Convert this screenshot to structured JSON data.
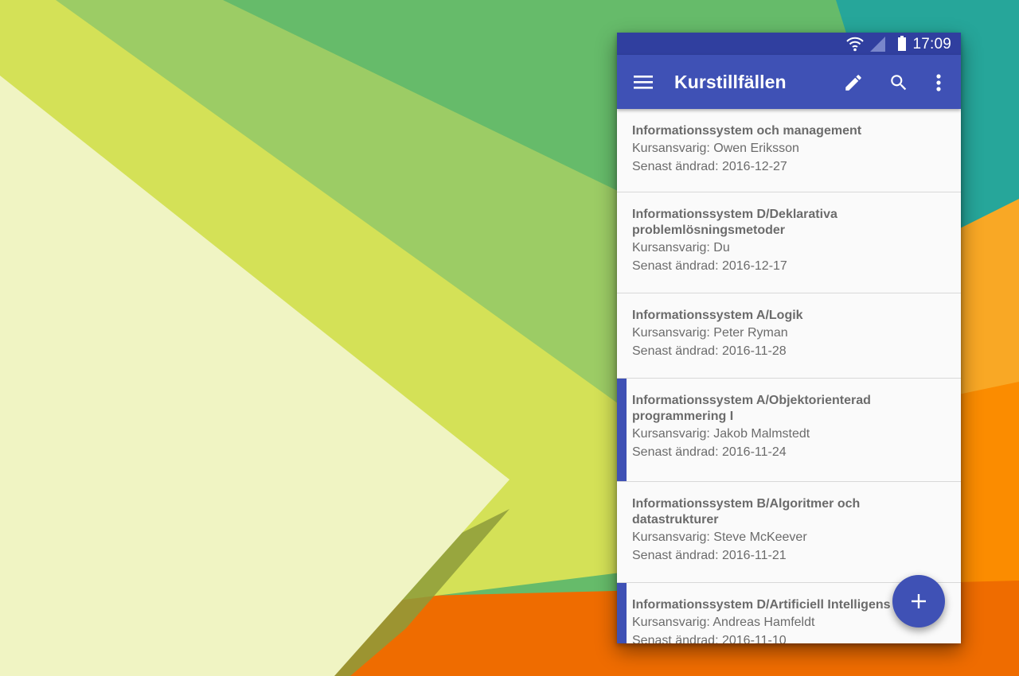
{
  "status_bar": {
    "time": "17:09",
    "icons": [
      "wifi-icon",
      "cell-signal-icon",
      "battery-icon"
    ]
  },
  "app_bar": {
    "title": "Kurstillfällen",
    "actions": [
      "menu-icon",
      "edit-icon",
      "search-icon",
      "more-vert-icon"
    ]
  },
  "courses": [
    {
      "title": "Informationssystem och management",
      "responsible": "Kursansvarig: Owen Eriksson",
      "modified": "Senast ändrad: 2016-12-27",
      "selected": false
    },
    {
      "title": "Informationssystem D/Deklarativa problemlösningsmetoder",
      "responsible": "Kursansvarig: Du",
      "modified": "Senast ändrad: 2016-12-17",
      "selected": false
    },
    {
      "title": "Informationssystem A/Logik",
      "responsible": "Kursansvarig: Peter Ryman",
      "modified": "Senast ändrad: 2016-11-28",
      "selected": false
    },
    {
      "title": "Informationssystem A/Objektorienterad programmering I",
      "responsible": "Kursansvarig: Jakob Malmstedt",
      "modified": "Senast ändrad: 2016-11-24",
      "selected": true
    },
    {
      "title": "Informationssystem B/Algoritmer och datastrukturer",
      "responsible": "Kursansvarig: Steve McKeever",
      "modified": "Senast ändrad: 2016-11-21",
      "selected": false
    },
    {
      "title": "Informationssystem D/Artificiell Intelligens",
      "responsible": "Kursansvarig: Andreas Hamfeldt",
      "modified": "Senast ändrad: 2016-11-10",
      "selected": true
    }
  ],
  "fab": {
    "icon": "add-icon",
    "label": "+"
  },
  "colors": {
    "primary": "#3f51b5",
    "primary_dark": "#303f9f",
    "list_background": "#fafafa",
    "text": "#6b6b6b"
  }
}
